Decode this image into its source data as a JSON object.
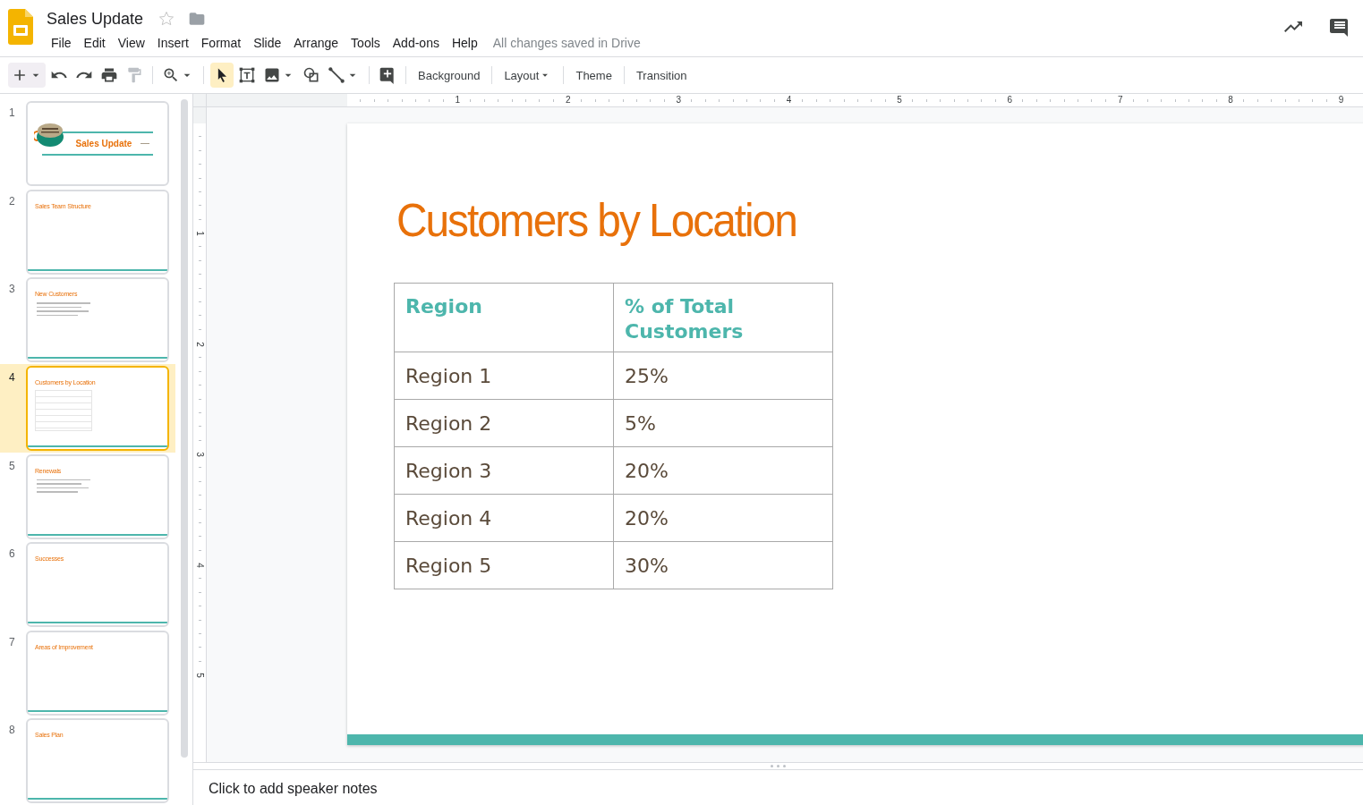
{
  "document": {
    "title": "Sales Update",
    "starred": false,
    "status": "All changes saved in Drive"
  },
  "menu": [
    "File",
    "Edit",
    "View",
    "Insert",
    "Format",
    "Slide",
    "Arrange",
    "Tools",
    "Add-ons",
    "Help"
  ],
  "toolbar": {
    "tools": [
      {
        "kind": "select",
        "selected": true
      },
      {
        "kind": "text-box",
        "selected": false
      },
      {
        "kind": "image",
        "selected": false
      },
      {
        "kind": "shape",
        "selected": false
      },
      {
        "kind": "line",
        "selected": false
      }
    ],
    "text_buttons": [
      {
        "label": "Background",
        "dropdown": false
      },
      {
        "label": "Layout",
        "dropdown": true
      },
      {
        "label": "Theme",
        "dropdown": false
      },
      {
        "label": "Transition",
        "dropdown": false
      }
    ]
  },
  "slides": [
    {
      "number": "1",
      "title": "Sales Update",
      "kind": "title",
      "selected": false
    },
    {
      "number": "2",
      "title": "Sales Team Structure",
      "kind": "blank",
      "selected": false
    },
    {
      "number": "3",
      "title": "New Customers",
      "kind": "bullets",
      "selected": false
    },
    {
      "number": "4",
      "title": "Customers by Location",
      "kind": "table",
      "selected": true
    },
    {
      "number": "5",
      "title": "Renewals",
      "kind": "bullets",
      "selected": false
    },
    {
      "number": "6",
      "title": "Successes",
      "kind": "blank",
      "selected": false
    },
    {
      "number": "7",
      "title": "Areas of Improvement",
      "kind": "blank",
      "selected": false
    },
    {
      "number": "8",
      "title": "Sales Plan",
      "kind": "blank",
      "selected": false
    }
  ],
  "ruler": {
    "horizontal": [
      "1",
      "2",
      "3",
      "4",
      "5",
      "6",
      "7",
      "8",
      "9"
    ],
    "vertical": [
      "1",
      "2",
      "3",
      "4",
      "5"
    ]
  },
  "slide": {
    "title": "Customers by Location",
    "table": {
      "columns": [
        "Region",
        "% of Total Customers"
      ],
      "rows": [
        [
          "Region 1",
          "25%"
        ],
        [
          "Region 2",
          "5%"
        ],
        [
          "Region 3",
          "20%"
        ],
        [
          "Region 4",
          "20%"
        ],
        [
          "Region 5",
          "30%"
        ]
      ]
    }
  },
  "notes": {
    "placeholder": "Click to add speaker notes"
  }
}
